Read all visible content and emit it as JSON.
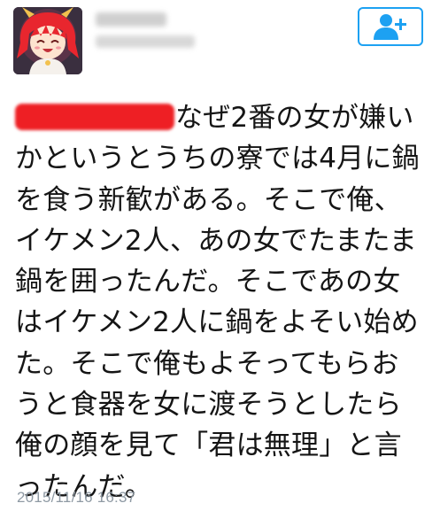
{
  "tweet": {
    "avatar_icon": "anime-avatar-icon",
    "follow_icon": "add-user-icon",
    "accent_color": "#1da1f2",
    "redaction_color": "#ee1f24",
    "text_lines": [
      "なぜ2番の女が嫌い",
      "かというとうちの寮では4月に鍋",
      "を食う新歓がある。そこで俺、",
      "イケメン2人、あの女でたまたま",
      "鍋を囲ったんだ。そこであの女",
      "はイケメン2人に鍋をよそい始め",
      "た。そこで俺もよそってもらお",
      "うと食器を女に渡そうとしたら",
      "俺の顔を見て「君は無理」と言",
      "ったんだ。"
    ],
    "timestamp": "2015/11/16 16:37"
  }
}
